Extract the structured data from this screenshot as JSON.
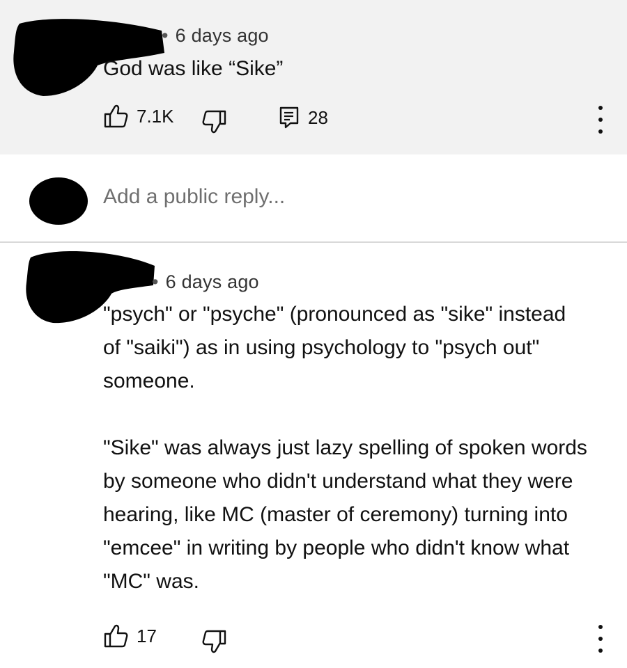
{
  "comments": [
    {
      "time": "6 days ago",
      "text_lines": [
        "God was like “Sike”"
      ],
      "likes": "7.1K",
      "replies": "28"
    },
    {
      "time": "6 days ago",
      "text_lines": [
        "\"psych\" or \"psyche\" (pronounced as \"sike\" instead",
        "of \"saiki\") as in using psychology to \"psych out\"",
        "someone.",
        "",
        "\"Sike\" was always just lazy spelling of spoken words",
        "by someone who didn't understand what they were",
        "hearing, like MC (master of ceremony) turning into",
        "\"emcee\" in writing by people who didn't know what",
        "\"MC\" was."
      ],
      "likes": "17"
    }
  ],
  "reply_box": {
    "placeholder": "Add a public reply..."
  },
  "icons": {
    "like": "thumbs-up-icon",
    "dislike": "thumbs-down-icon",
    "reply": "comment-icon",
    "more": "more-vert-icon",
    "avatar": "redacted-avatar"
  },
  "colors": {
    "top_comment_bg": "#f2f2f2",
    "text": "#0f0f0f",
    "placeholder": "#6f6f6f",
    "redaction": "#000000"
  }
}
